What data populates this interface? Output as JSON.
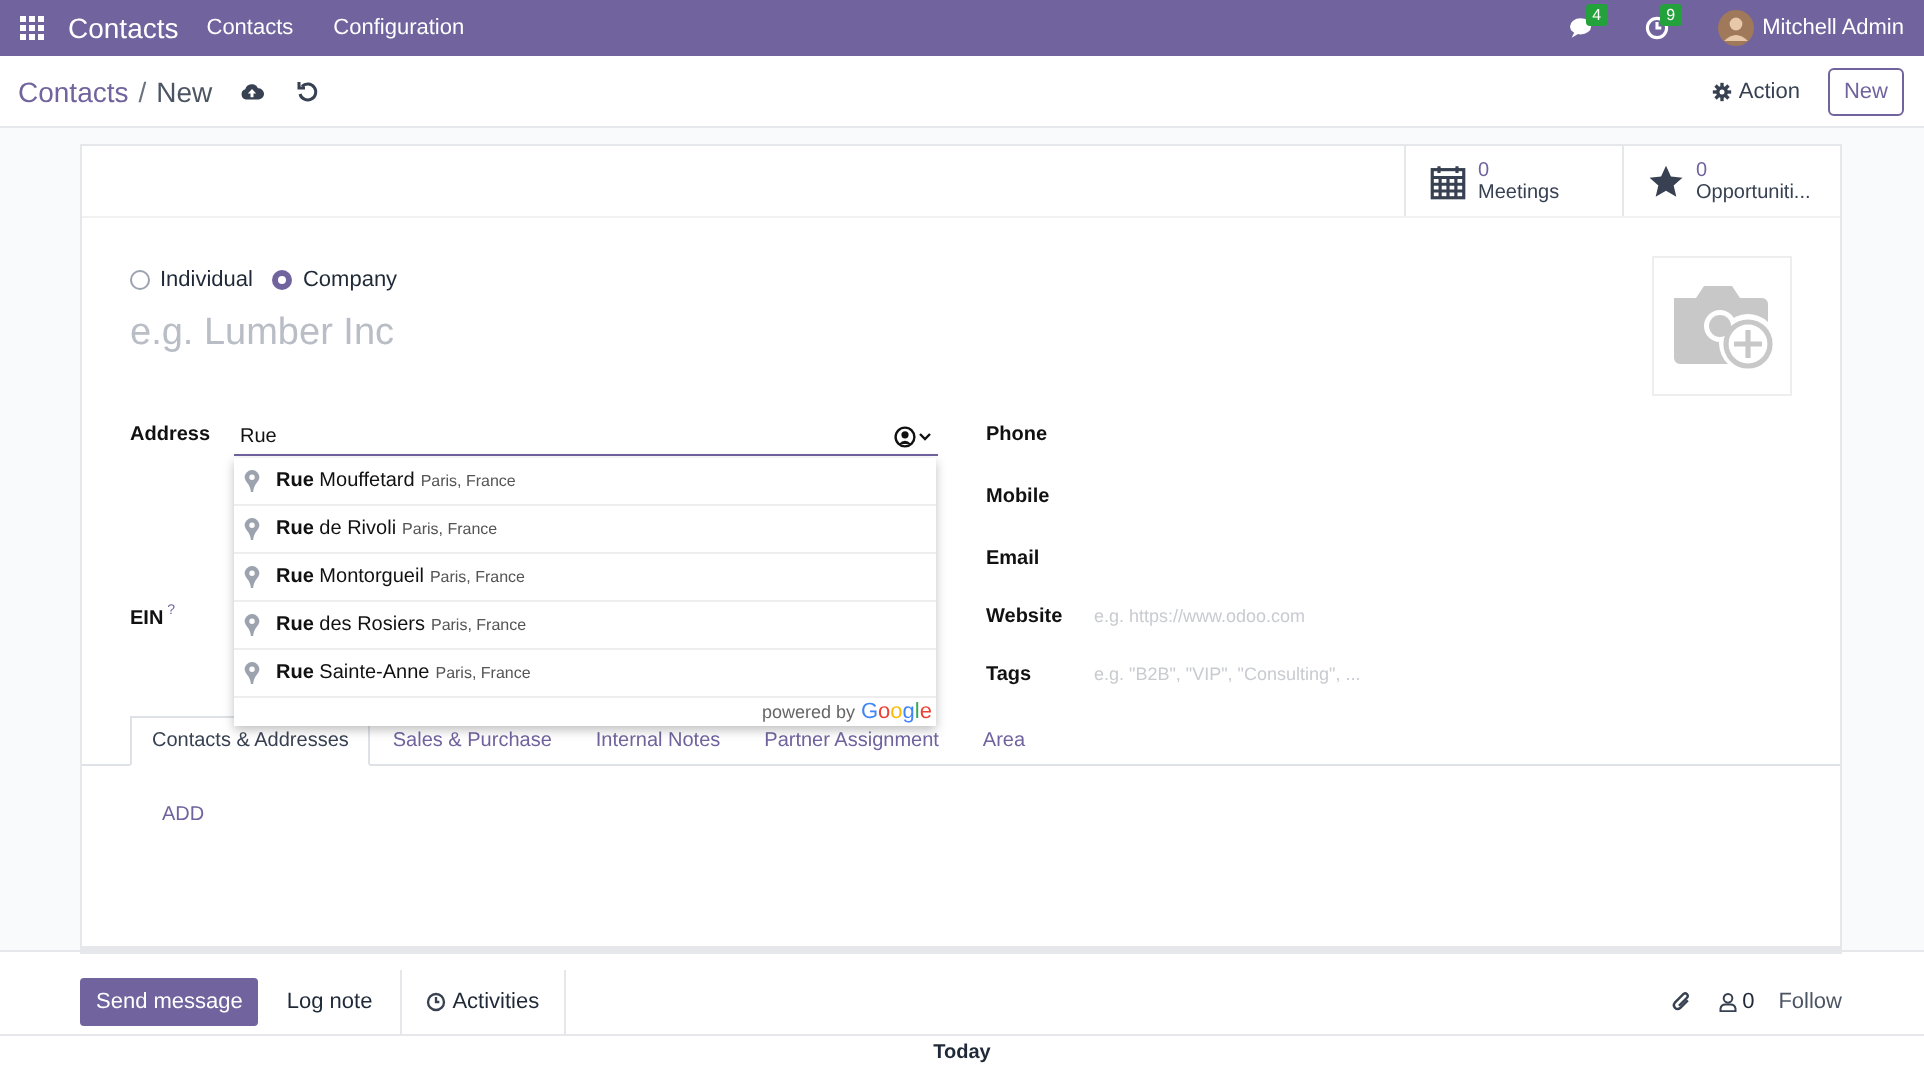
{
  "navbar": {
    "app_name": "Contacts",
    "menu": [
      "Contacts",
      "Configuration"
    ],
    "messages_count": "4",
    "activities_count": "9",
    "user": "Mitchell Admin"
  },
  "control_panel": {
    "breadcrumb_parent": "Contacts",
    "breadcrumb_separator": "/",
    "breadcrumb_current": "New",
    "action": "Action",
    "new_button": "New"
  },
  "stat_buttons": [
    {
      "kind": "calendar",
      "value": "0",
      "label": "Meetings"
    },
    {
      "kind": "star",
      "value": "0",
      "label": "Opportuniti..."
    }
  ],
  "company_type": [
    {
      "label": "Individual",
      "selected": false
    },
    {
      "label": "Company",
      "selected": true
    }
  ],
  "name_placeholder": "e.g. Lumber Inc",
  "left_fields": [
    {
      "label": "Address",
      "value": "Rue",
      "kind": "address"
    },
    {
      "label": "EIN",
      "help": "?",
      "kind": "plain"
    }
  ],
  "right_fields": [
    {
      "label": "Phone"
    },
    {
      "label": "Mobile"
    },
    {
      "label": "Email"
    },
    {
      "label": "Website",
      "placeholder": "e.g. https://www.odoo.com"
    },
    {
      "label": "Tags",
      "placeholder": "e.g. \"B2B\", \"VIP\", \"Consulting\", ..."
    }
  ],
  "autocomplete": {
    "items": [
      {
        "street": "**Rue** Mouffetard",
        "locality": "Paris, France"
      },
      {
        "street": "**Rue** de Rivoli",
        "locality": "Paris, France"
      },
      {
        "street": "**Rue** Montorgueil",
        "locality": "Paris, France"
      },
      {
        "street": "**Rue** des Rosiers",
        "locality": "Paris, France"
      },
      {
        "street": "**Rue** Sainte-Anne",
        "locality": "Paris, France"
      }
    ],
    "footer": "powered by",
    "brand": "Google"
  },
  "tabs": [
    {
      "label": "Contacts & Addresses",
      "selected": true
    },
    {
      "label": "Sales & Purchase",
      "selected": false
    },
    {
      "label": "Internal Notes",
      "selected": false
    },
    {
      "label": "Partner Assignment",
      "selected": false
    },
    {
      "label": "Area",
      "selected": false
    }
  ],
  "add_link": "ADD",
  "chatter": {
    "send_message": "Send message",
    "log_note": "Log note",
    "activities": "Activities",
    "followers_count": "0",
    "follow": "Follow",
    "date_separator": "Today"
  }
}
